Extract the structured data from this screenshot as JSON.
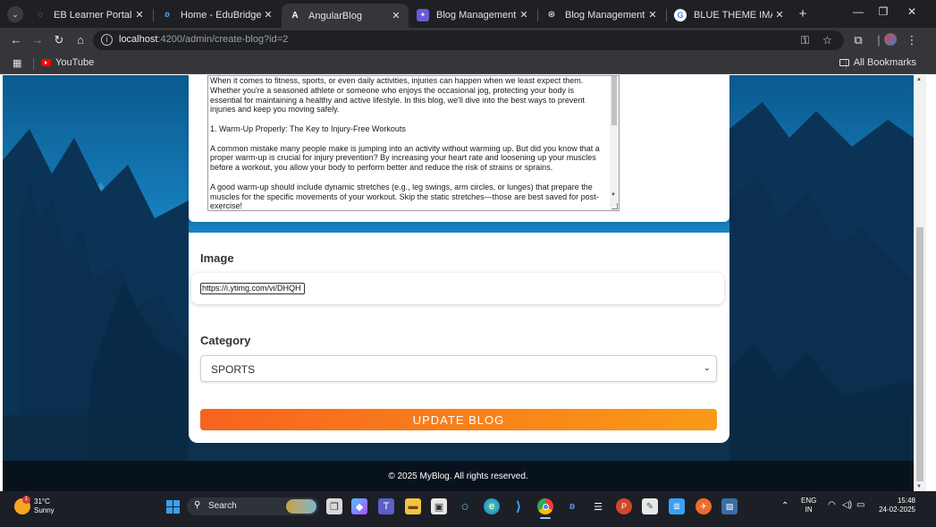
{
  "browser": {
    "tabs": [
      {
        "title": "EB Learner Portal",
        "icon": "loader-icon",
        "active": false
      },
      {
        "title": "Home - EduBridge",
        "icon": "edubridge-icon",
        "active": false
      },
      {
        "title": "AngularBlog",
        "icon": "angular-icon",
        "active": true
      },
      {
        "title": "Blog Management system",
        "icon": "chat-icon",
        "active": false
      },
      {
        "title": "Blog Management System",
        "icon": "openai-icon",
        "active": false
      },
      {
        "title": "BLUE THEME IMAGE OG H",
        "icon": "google-icon",
        "active": false
      }
    ],
    "url_host": "localhost",
    "url_path": ":4200/admin/create-blog?id=2",
    "bookmarks": {
      "youtube": "YouTube",
      "all": "All Bookmarks"
    }
  },
  "form": {
    "content_paragraphs": [
      "When it comes to fitness, sports, or even daily activities, injuries can happen when we least expect them. Whether you're a seasoned athlete or someone who enjoys the occasional jog, protecting your body is essential for maintaining a healthy and active lifestyle. In this blog, we'll dive into the best ways to prevent injuries and keep you moving safely.",
      "1. Warm-Up Properly: The Key to Injury-Free Workouts",
      "A common mistake many people make is jumping into an activity without warming up. But did you know that a proper warm-up is crucial for injury prevention? By increasing your heart rate and loosening up your muscles before a workout, you allow your body to perform better and reduce the risk of strains or sprains.",
      "A good warm-up should include dynamic stretches (e.g., leg swings, arm circles, or lunges) that prepare the muscles for the specific movements of your workout. Skip the static stretches—those are best saved for post-exercise!"
    ],
    "image_label": "Image",
    "image_value": "https://i.ytimg.com/vi/DHQH",
    "category_label": "Category",
    "category_value": "SPORTS",
    "submit_label": "UPDATE BLOG"
  },
  "footer": {
    "text": "© 2025 MyBlog. All rights reserved."
  },
  "taskbar": {
    "weather_temp": "31°C",
    "weather_desc": "Sunny",
    "weather_badge": "1",
    "search_label": "Search",
    "lang_top": "ENG",
    "lang_bottom": "IN",
    "time": "15:48",
    "date": "24-02-2025"
  },
  "colors": {
    "accent_start": "#f7631e",
    "accent_end": "#fa9a17",
    "footer_bg": "#08121c"
  }
}
